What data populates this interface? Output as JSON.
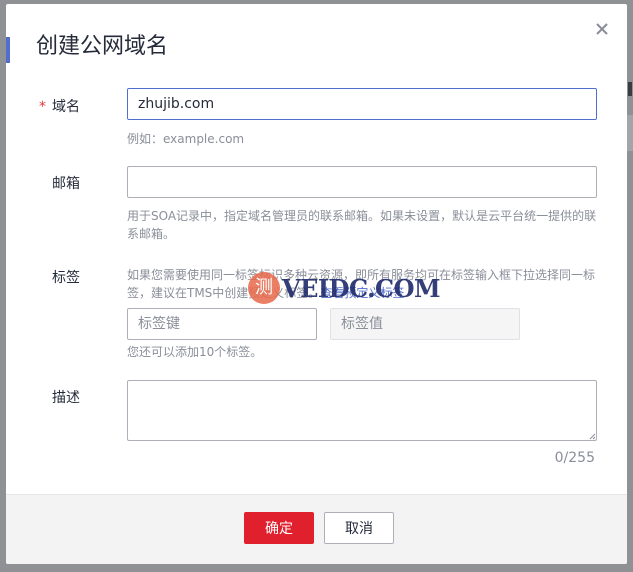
{
  "dialog": {
    "title": "创建公网域名",
    "close_label": "×"
  },
  "form": {
    "domain": {
      "required_mark": "*",
      "label": "域名",
      "value": "zhujib.com",
      "hint": "例如：example.com"
    },
    "email": {
      "label": "邮箱",
      "value": "",
      "hint": "用于SOA记录中，指定域名管理员的联系邮箱。如果未设置，默认是云平台统一提供的联系邮箱。"
    },
    "tags": {
      "label": "标签",
      "hint_line1": "如果您需要使用同一标签标识多种云资源，即所有服务均可在标签输入框下拉选择同一标",
      "hint_line2_prefix": "签，建议在TMS中创建预定义标签。",
      "hint_link": "查看预定义标签",
      "key_placeholder": "标签键",
      "value_placeholder": "标签值",
      "remaining": "您还可以添加10个标签。"
    },
    "description": {
      "label": "描述",
      "value": "",
      "counter": "0/255"
    }
  },
  "footer": {
    "confirm_label": "确定",
    "cancel_label": "取消"
  },
  "watermark": {
    "badge": "测",
    "text": "VEIDC.COM"
  },
  "colors": {
    "primary": "#526ecc",
    "danger": "#e0202c",
    "required": "#e5353f"
  }
}
